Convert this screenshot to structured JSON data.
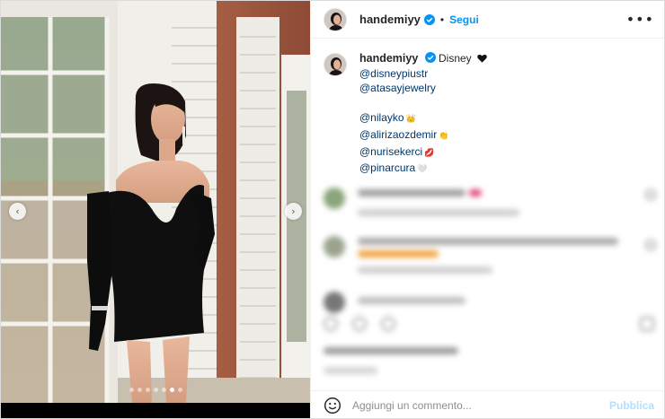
{
  "post": {
    "username": "handemiyy",
    "separator": "•",
    "follow_label": "Segui",
    "more_label": "•••"
  },
  "caption": {
    "username": "handemiyy",
    "text": "Disney",
    "mentions": [
      "@disneypiustr",
      "@atasayjewelry",
      "",
      "@nilayko",
      "@alirizaozdemir",
      "@nurisekerci",
      "@pinarcura"
    ],
    "mention_emojis": [
      "",
      "",
      "",
      "👑",
      "👏",
      "💋",
      "🤍"
    ]
  },
  "carousel": {
    "prev_label": "‹",
    "next_label": "›",
    "dot_count": 7,
    "active_dot": 5
  },
  "comment_bar": {
    "placeholder": "Aggiungi un commento...",
    "publish_label": "Pubblica"
  },
  "icons": {
    "verified": "verified-badge-icon",
    "more": "more-options-icon",
    "emoji": "emoji-icon",
    "prev": "chevron-left-icon",
    "next": "chevron-right-icon"
  },
  "colors": {
    "link": "#0095f6",
    "mention": "#00376b",
    "publish_disabled": "#b2dffc",
    "border": "#dbdbdb"
  }
}
